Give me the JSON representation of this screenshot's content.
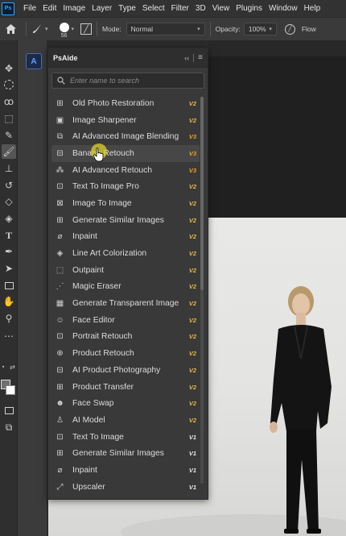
{
  "menubar": {
    "logo": "Ps",
    "items": [
      "File",
      "Edit",
      "Image",
      "Layer",
      "Type",
      "Select",
      "Filter",
      "3D",
      "View",
      "Plugins",
      "Window",
      "Help"
    ]
  },
  "options": {
    "brush_size": "56",
    "mode_label": "Mode:",
    "mode_value": "Normal",
    "opacity_label": "Opacity:",
    "opacity_value": "100%",
    "flow_label": "Flow"
  },
  "panel_strip": {
    "button_label": "A"
  },
  "panel": {
    "tab_title": "PsAide",
    "collapse_glyph": "‹‹",
    "search_placeholder": "Enter name to search",
    "items": [
      {
        "label": "Old Photo Restoration",
        "badge": "V2",
        "icon": "photo-restore-icon"
      },
      {
        "label": "Image Sharpener",
        "badge": "V2",
        "icon": "sharpen-icon"
      },
      {
        "label": "AI Advanced Image Blending",
        "badge": "V3",
        "icon": "blend-icon"
      },
      {
        "label": "Banana Retouch",
        "badge": "V3",
        "icon": "retouch-icon"
      },
      {
        "label": "AI Advanced Retouch",
        "badge": "V3",
        "icon": "sparkle-wand-icon"
      },
      {
        "label": "Text To Image Pro",
        "badge": "V2",
        "icon": "text-image-icon"
      },
      {
        "label": "Image To Image",
        "badge": "V2",
        "icon": "image-swap-icon"
      },
      {
        "label": "Generate Similar Images",
        "badge": "V2",
        "icon": "similar-images-icon"
      },
      {
        "label": "Inpaint",
        "badge": "V2",
        "icon": "brush-icon"
      },
      {
        "label": "Line Art Colorization",
        "badge": "V2",
        "icon": "paint-bucket-icon"
      },
      {
        "label": "Outpaint",
        "badge": "V2",
        "icon": "outpaint-icon"
      },
      {
        "label": "Magic Eraser",
        "badge": "V2",
        "icon": "magic-wand-icon"
      },
      {
        "label": "Generate Transparent Image",
        "badge": "V2",
        "icon": "transparent-image-icon"
      },
      {
        "label": "Face Editor",
        "badge": "V2",
        "icon": "face-icon"
      },
      {
        "label": "Portrait Retouch",
        "badge": "V2",
        "icon": "portrait-icon"
      },
      {
        "label": "Product Retouch",
        "badge": "V2",
        "icon": "product-icon"
      },
      {
        "label": "AI Product Photography",
        "badge": "V2",
        "icon": "camera-icon"
      },
      {
        "label": "Product Transfer",
        "badge": "V2",
        "icon": "transfer-icon"
      },
      {
        "label": "Face Swap",
        "badge": "V2",
        "icon": "face-swap-icon"
      },
      {
        "label": "AI Model",
        "badge": "V2",
        "icon": "model-icon"
      },
      {
        "label": "Text To Image",
        "badge": "V1",
        "icon": "text-image-icon"
      },
      {
        "label": "Generate Similar Images",
        "badge": "V1",
        "icon": "similar-images-icon"
      },
      {
        "label": "Inpaint",
        "badge": "V1",
        "icon": "brush-icon"
      },
      {
        "label": "Upscaler",
        "badge": "V1",
        "icon": "upscale-icon"
      }
    ]
  },
  "colors": {
    "badge_v1": "#e6e6e6",
    "badge_v2": "#e8b84a",
    "badge_v3": "#f0a21c",
    "accent": "#31a8ff"
  }
}
